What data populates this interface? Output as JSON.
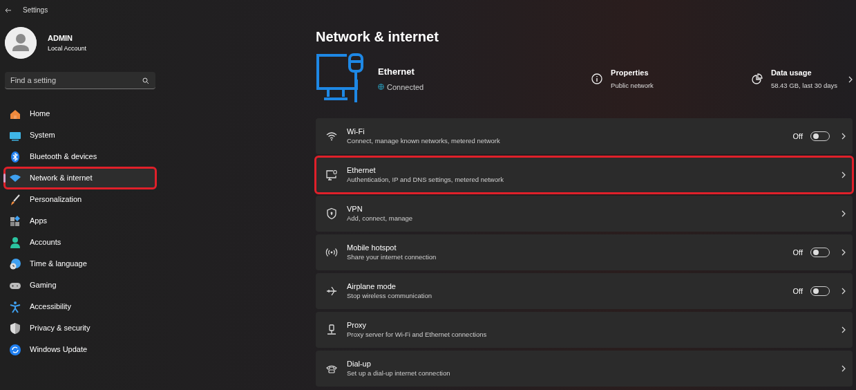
{
  "window": {
    "title": "Settings"
  },
  "account": {
    "name": "ADMIN",
    "type": "Local Account"
  },
  "search": {
    "placeholder": "Find a setting"
  },
  "sidebar": {
    "items": [
      {
        "label": "Home",
        "selected": false,
        "highlighted": false
      },
      {
        "label": "System",
        "selected": false,
        "highlighted": false
      },
      {
        "label": "Bluetooth & devices",
        "selected": false,
        "highlighted": false
      },
      {
        "label": "Network & internet",
        "selected": true,
        "highlighted": true
      },
      {
        "label": "Personalization",
        "selected": false,
        "highlighted": false
      },
      {
        "label": "Apps",
        "selected": false,
        "highlighted": false
      },
      {
        "label": "Accounts",
        "selected": false,
        "highlighted": false
      },
      {
        "label": "Time & language",
        "selected": false,
        "highlighted": false
      },
      {
        "label": "Gaming",
        "selected": false,
        "highlighted": false
      },
      {
        "label": "Accessibility",
        "selected": false,
        "highlighted": false
      },
      {
        "label": "Privacy & security",
        "selected": false,
        "highlighted": false
      },
      {
        "label": "Windows Update",
        "selected": false,
        "highlighted": false
      }
    ]
  },
  "page": {
    "title": "Network & internet"
  },
  "connection": {
    "name": "Ethernet",
    "status": "Connected"
  },
  "properties": {
    "title": "Properties",
    "value": "Public network"
  },
  "data_usage": {
    "title": "Data usage",
    "value": "58.43 GB, last 30 days"
  },
  "settings": [
    {
      "kind": "toggle",
      "title": "Wi-Fi",
      "subtitle": "Connect, manage known networks, metered network",
      "state": "Off",
      "on": false,
      "highlighted": false
    },
    {
      "kind": "link",
      "title": "Ethernet",
      "subtitle": "Authentication, IP and DNS settings, metered network",
      "highlighted": true
    },
    {
      "kind": "link",
      "title": "VPN",
      "subtitle": "Add, connect, manage",
      "highlighted": false
    },
    {
      "kind": "toggle",
      "title": "Mobile hotspot",
      "subtitle": "Share your internet connection",
      "state": "Off",
      "on": false,
      "highlighted": false
    },
    {
      "kind": "toggle",
      "title": "Airplane mode",
      "subtitle": "Stop wireless communication",
      "state": "Off",
      "on": false,
      "highlighted": false
    },
    {
      "kind": "link",
      "title": "Proxy",
      "subtitle": "Proxy server for Wi-Fi and Ethernet connections",
      "highlighted": false
    },
    {
      "kind": "link",
      "title": "Dial-up",
      "subtitle": "Set up a dial-up internet connection",
      "highlighted": false
    }
  ]
}
